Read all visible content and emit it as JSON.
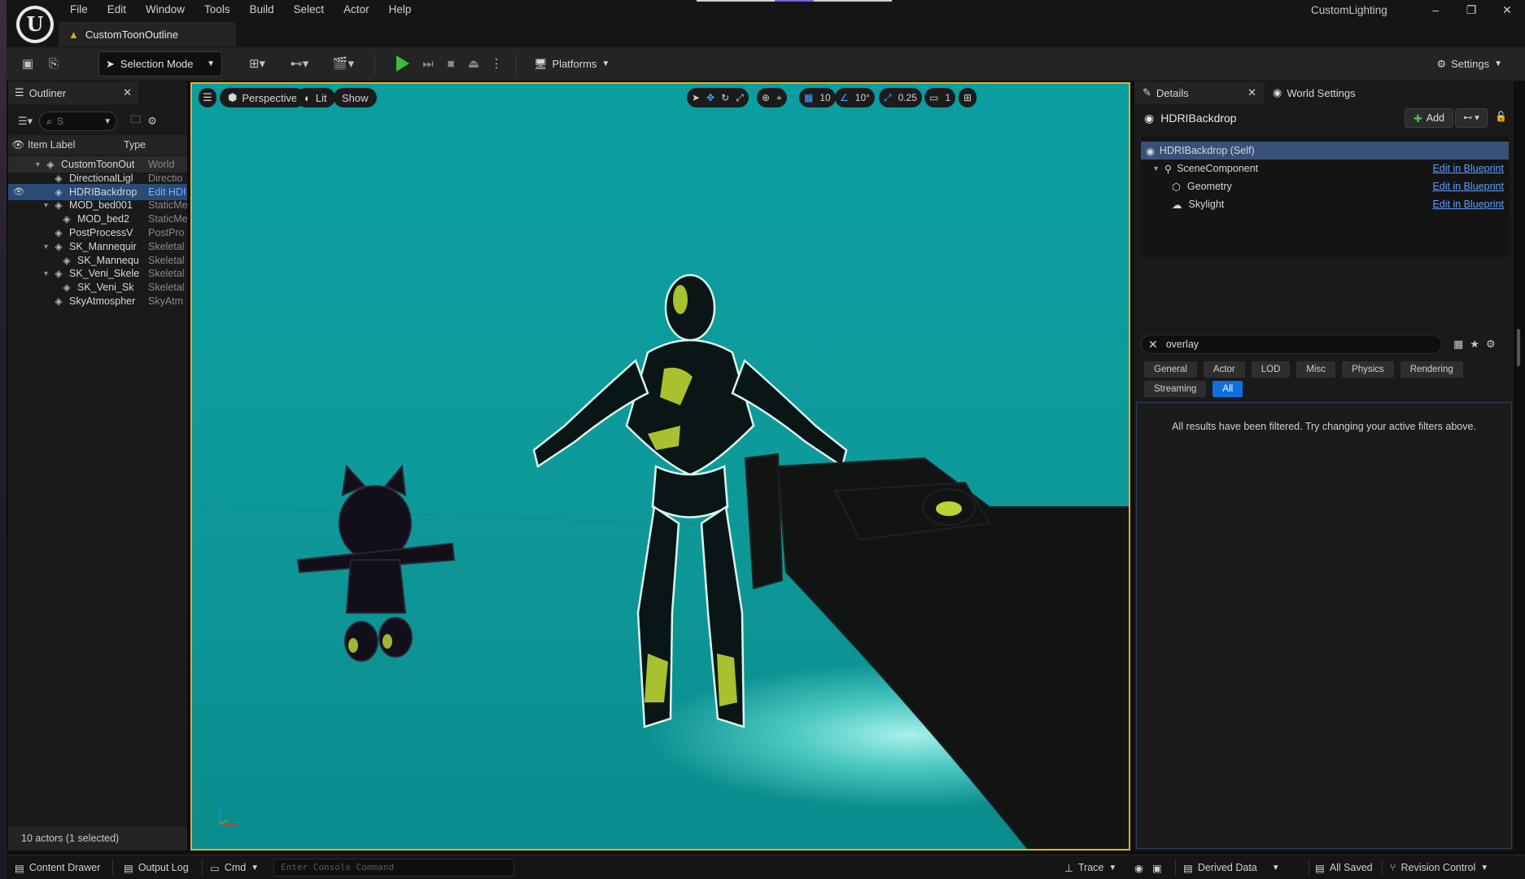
{
  "app": {
    "project": "CustomLighting",
    "level_tab": "CustomToonOutline",
    "window_controls": [
      "–",
      "❐",
      "✕"
    ]
  },
  "menu": [
    "File",
    "Edit",
    "Window",
    "Tools",
    "Build",
    "Select",
    "Actor",
    "Help"
  ],
  "toolbar": {
    "selection_mode": "Selection Mode",
    "platforms": "Platforms",
    "settings": "Settings"
  },
  "outliner": {
    "tab_label": "Outliner",
    "search_text": "S",
    "col_label": "Item Label",
    "col_type": "Type",
    "rows": [
      {
        "label": "CustomToonOut",
        "type": "World",
        "indent": 0,
        "icon": "world-icon",
        "arrow": "▼"
      },
      {
        "label": "DirectionalLigl",
        "type": "Directio",
        "indent": 1,
        "icon": "light-icon",
        "arrow": ""
      },
      {
        "label": "HDRIBackdrop",
        "type": "Edit HDI",
        "indent": 1,
        "icon": "backdrop-icon",
        "arrow": ""
      },
      {
        "label": "MOD_bed001",
        "type": "StaticMe",
        "indent": 1,
        "icon": "mesh-icon",
        "arrow": "▼"
      },
      {
        "label": "MOD_bed2",
        "type": "StaticMe",
        "indent": 2,
        "icon": "mesh-icon",
        "arrow": ""
      },
      {
        "label": "PostProcessV",
        "type": "PostPro",
        "indent": 1,
        "icon": "postprocess-icon",
        "arrow": ""
      },
      {
        "label": "SK_Mannequir",
        "type": "Skeletal",
        "indent": 1,
        "icon": "skeletal-icon",
        "arrow": "▼"
      },
      {
        "label": "SK_Mannequ",
        "type": "Skeletal",
        "indent": 2,
        "icon": "skeletal-icon",
        "arrow": ""
      },
      {
        "label": "SK_Veni_Skele",
        "type": "Skeletal",
        "indent": 1,
        "icon": "skeletal-icon",
        "arrow": "▼"
      },
      {
        "label": "SK_Veni_Sk",
        "type": "Skeletal",
        "indent": 2,
        "icon": "skeletal-icon",
        "arrow": ""
      },
      {
        "label": "SkyAtmospher",
        "type": "SkyAtm",
        "indent": 1,
        "icon": "sky-icon",
        "arrow": ""
      }
    ],
    "footer": "10 actors (1 selected)"
  },
  "viewport": {
    "view_mode": "Perspective",
    "lighting": "Lit",
    "show": "Show",
    "grid_size": "10",
    "rotation_snap": "10°",
    "scale_snap": "0.25",
    "camera_speed": "1"
  },
  "details": {
    "tab_details": "Details",
    "tab_world_settings": "World Settings",
    "actor_name": "HDRIBackdrop",
    "add_label": "Add",
    "components": [
      {
        "label": "HDRIBackdrop (Self)",
        "edit": ""
      },
      {
        "label": "SceneComponent",
        "edit": "Edit in Blueprint"
      },
      {
        "label": "Geometry",
        "edit": "Edit in Blueprint"
      },
      {
        "label": "Skylight",
        "edit": "Edit in Blueprint"
      }
    ],
    "search_value": "overlay",
    "categories_row1": [
      "General",
      "Actor",
      "LOD",
      "Misc",
      "Physics",
      "Rendering"
    ],
    "categories_row2": [
      "Streaming",
      "All"
    ],
    "active_category": "All",
    "empty_message": "All results have been filtered. Try changing your active filters above."
  },
  "statusbar": {
    "content_drawer": "Content Drawer",
    "output_log": "Output Log",
    "cmd": "Cmd",
    "console_placeholder": "Enter Console Command",
    "trace": "Trace",
    "derived_data": "Derived Data",
    "all_saved": "All Saved",
    "revision_control": "Revision Control"
  },
  "colors": {
    "accent_blue": "#0f6fde",
    "selection_blue": "#2a4a78",
    "viewport_teal": "#0e9a9a",
    "viewport_border": "#e0b224",
    "play_green": "#3cbe3c"
  }
}
